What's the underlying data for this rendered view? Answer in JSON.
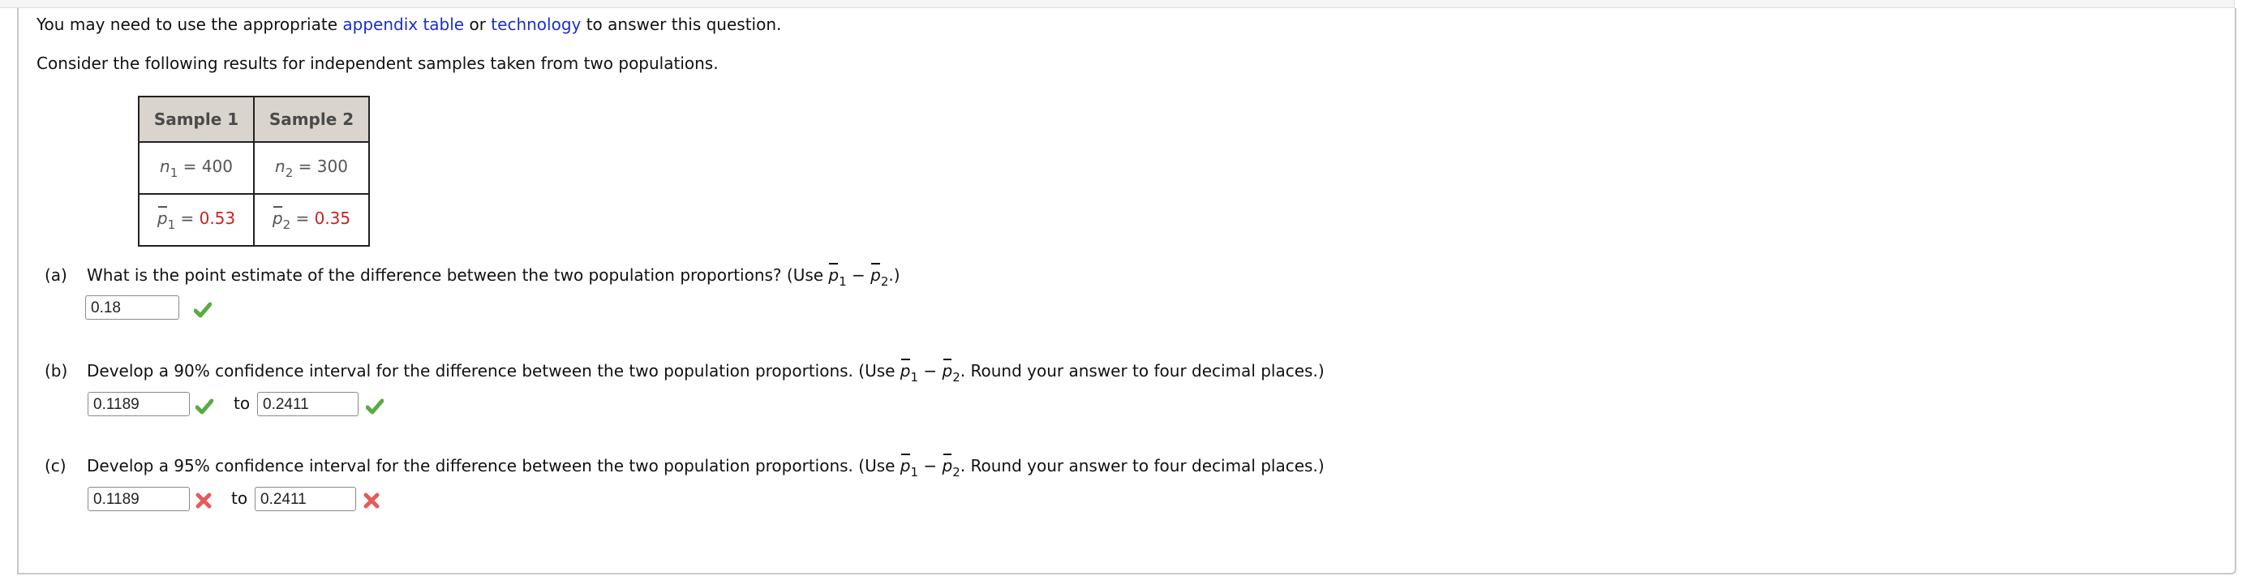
{
  "intro": {
    "prefix": "You may need to use the appropriate ",
    "link1": "appendix table",
    "middle": " or ",
    "link2": "technology",
    "suffix": " to answer this question."
  },
  "context": "Consider the following results for independent samples taken from two populations.",
  "table": {
    "headers": [
      "Sample 1",
      "Sample 2"
    ],
    "rows": [
      [
        {
          "var": "n",
          "sub": "1",
          "eq": " = ",
          "value": "400"
        },
        {
          "var": "n",
          "sub": "2",
          "eq": " = ",
          "value": "300"
        }
      ],
      [
        {
          "var": "p",
          "sub": "1",
          "eq": " = ",
          "value": "0.53"
        },
        {
          "var": "p",
          "sub": "2",
          "eq": " = ",
          "value": "0.35"
        }
      ]
    ]
  },
  "colors": {
    "link": "#1a2ecc",
    "given_value": "#c8251e",
    "correct": "#5aab46",
    "incorrect": "#e25c5c"
  },
  "parts": [
    {
      "label": "(a)",
      "question": "What is the point estimate of the difference between the two population proportions? (Use ",
      "expr_a": "p",
      "sub1": "1",
      "minus": " − ",
      "expr_b": "p",
      "sub2": "2",
      "question_end": ".)",
      "answers": [
        {
          "value": "0.18",
          "status": "correct"
        }
      ]
    },
    {
      "label": "(b)",
      "question": "Develop a 90% confidence interval for the difference between the two population proportions. (Use ",
      "expr_a": "p",
      "sub1": "1",
      "minus": " − ",
      "expr_b": "p",
      "sub2": "2",
      "question_end": ". Round your answer to four decimal places.)",
      "to_label": "to",
      "answers": [
        {
          "value": "0.1189",
          "status": "correct"
        },
        {
          "value": "0.2411",
          "status": "correct"
        }
      ]
    },
    {
      "label": "(c)",
      "question": "Develop a 95% confidence interval for the difference between the two population proportions. (Use ",
      "expr_a": "p",
      "sub1": "1",
      "minus": " − ",
      "expr_b": "p",
      "sub2": "2",
      "question_end": ". Round your answer to four decimal places.)",
      "to_label": "to",
      "answers": [
        {
          "value": "0.1189",
          "status": "incorrect"
        },
        {
          "value": "0.2411",
          "status": "incorrect"
        }
      ]
    }
  ]
}
